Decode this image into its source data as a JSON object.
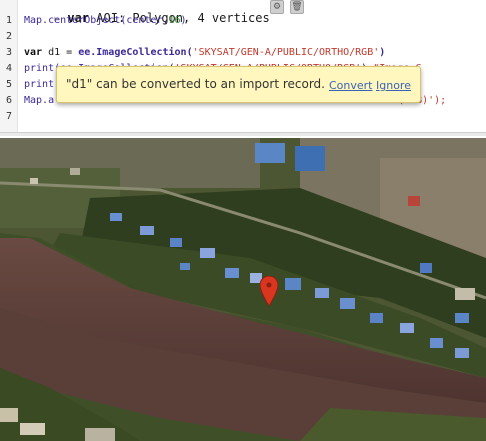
{
  "editor": {
    "line_numbers": [
      "1",
      "2",
      "3",
      "4",
      "5",
      "6",
      "7"
    ],
    "line0": {
      "kw": "var",
      "name": "AOI",
      "rest": ": Polygon, 4 vertices"
    },
    "line1": {
      "fn": "Map.centerObject(center,",
      "num": "16",
      "end": ")"
    },
    "line3": {
      "kw": "var",
      "var": "d1",
      "eq": " = ",
      "fn": "ee.ImageCollection(",
      "str": "'SKYSAT/GEN-A/PUBLIC/ORTHO/RGB'",
      "end": ")"
    },
    "line4": {
      "fn": "print(",
      "hidden": "ee.ImageCollection",
      "str": "'SKYSAT/GEN-A/PUBLIC/ORTHO/RGB'",
      "tail": ",\"Image C"
    },
    "line5": {
      "fn": "print"
    },
    "line6": {
      "fn": "Map.a",
      "tail": "D1(RGB)');"
    }
  },
  "tooltip": {
    "message": "\"d1\" can be converted to an import record.",
    "convert": "Convert",
    "ignore": "Ignore"
  },
  "map": {
    "marker_color": "#d9361f",
    "river_color": "#5c3c36",
    "vegetation_color": "#2f3e1f"
  }
}
